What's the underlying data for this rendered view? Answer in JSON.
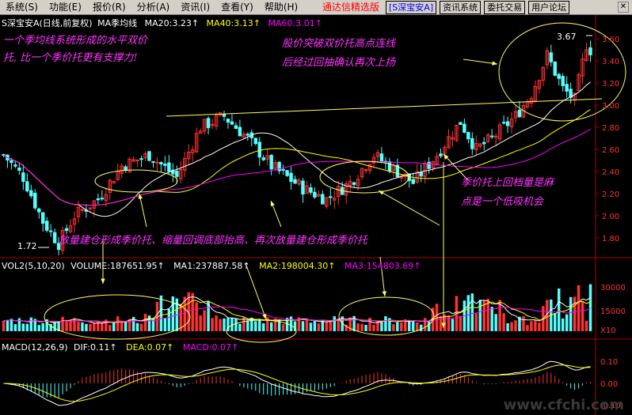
{
  "menu": {
    "items": [
      "系统(S)",
      "功能(E)",
      "报价(R)",
      "分析(A)",
      "资讯(I)",
      "查看(Y)",
      "帮助(H)"
    ],
    "brand_title": "通达信精选版",
    "brand_code": "[S深宝安A]",
    "buttons": [
      "资讯系统",
      "委托交易",
      "用户论坛"
    ]
  },
  "main_header": {
    "stock": "S深宝安A(日线,前复权)",
    "indicator": "MA季均线",
    "ma20": "MA20:3.23↑",
    "ma40": "MA40:3.13↑",
    "ma60": "MA60:3.01↑"
  },
  "vol_header": {
    "name": "VOL2(5,10,20)",
    "volume": "VOLUME:187651.95↑",
    "ma1": "MA1:237887.58↑",
    "ma2": "MA2:198004.30↑",
    "ma3": "MA3:154803.69↑"
  },
  "macd_header": {
    "name": "MACD(12,26,9)",
    "dif": "DIF:0.11↑",
    "dea": "DEA:0.07↑",
    "macd": "MACD:0.07↑"
  },
  "price_axis": [
    "3.60",
    "3.40",
    "3.20",
    "3.00",
    "2.80",
    "2.60",
    "2.40",
    "2.20",
    "2.00",
    "1.80"
  ],
  "vol_axis": [
    "30000",
    "15000",
    "X10"
  ],
  "macd_axis": [
    "0.10",
    "0.00",
    "-0.10"
  ],
  "markers": {
    "high": "3.67",
    "low": "1.72"
  },
  "annotations": {
    "a1_line1": "一个季均线系统形成的水平双价",
    "a1_line2": "托, 比一个季价托更有支撑力!",
    "a2_line1": "股价突破双价托高点连线",
    "a2_line2": "后经过回抽确认再次上扬",
    "a3_line1": "季价托上回档量是麻",
    "a3_line2": "点是一个低吸机会",
    "a4": "放量建仓形成季价托、缩量回调底部抬高、再次放量建仓形成季价托"
  },
  "watermark": "www.cfchi.com",
  "colors": {
    "up": "#ff3232",
    "down": "#54ffff",
    "ma20": "#ffffff",
    "ma40": "#ffff00",
    "ma60": "#ff00ff",
    "anno": "#ff33ff",
    "ellipse": "#ffff66"
  }
}
